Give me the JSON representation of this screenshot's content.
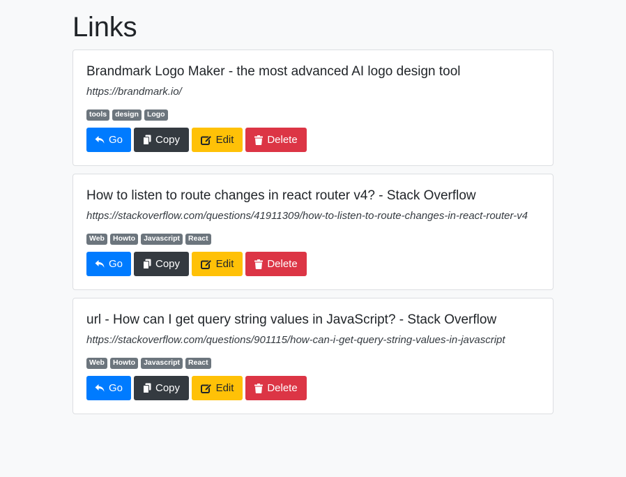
{
  "page": {
    "title": "Links"
  },
  "buttons": {
    "go": "Go",
    "copy": "Copy",
    "edit": "Edit",
    "delete": "Delete"
  },
  "icons": {
    "go": "reply-arrow-icon",
    "copy": "copy-icon",
    "edit": "edit-icon",
    "delete": "trash-icon"
  },
  "colors": {
    "go": "#007bff",
    "copy": "#343a40",
    "edit": "#ffc107",
    "delete": "#dc3545",
    "tag": "#6c757d"
  },
  "links": [
    {
      "title": "Brandmark Logo Maker - the most advanced AI logo design tool",
      "url": "https://brandmark.io/",
      "tags": [
        "tools",
        "design",
        "Logo"
      ]
    },
    {
      "title": "How to listen to route changes in react router v4? - Stack Overflow",
      "url": "https://stackoverflow.com/questions/41911309/how-to-listen-to-route-changes-in-react-router-v4",
      "tags": [
        "Web",
        "Howto",
        "Javascript",
        "React"
      ]
    },
    {
      "title": "url - How can I get query string values in JavaScript? - Stack Overflow",
      "url": "https://stackoverflow.com/questions/901115/how-can-i-get-query-string-values-in-javascript",
      "tags": [
        "Web",
        "Howto",
        "Javascript",
        "React"
      ]
    }
  ]
}
